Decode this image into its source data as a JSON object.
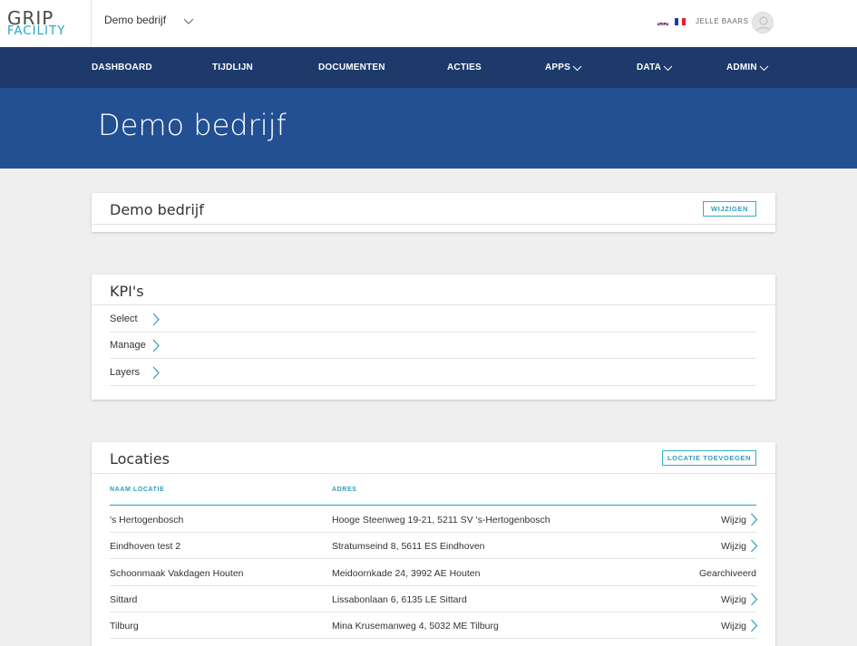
{
  "logo": {
    "top": "GRIP",
    "bottom": "FACILITY"
  },
  "header": {
    "company_select": "Demo bedrijf",
    "languages": [
      "en-flag-icon",
      "fr-flag-icon"
    ],
    "user_name": "JELLE BAARS"
  },
  "nav": {
    "items": [
      {
        "label": "DASHBOARD",
        "dropdown": false
      },
      {
        "label": "TIJDLIJN",
        "dropdown": false
      },
      {
        "label": "DOCUMENTEN",
        "dropdown": false
      },
      {
        "label": "ACTIES",
        "dropdown": false
      },
      {
        "label": "APPS",
        "dropdown": true
      },
      {
        "label": "DATA",
        "dropdown": true
      },
      {
        "label": "ADMIN",
        "dropdown": true
      }
    ]
  },
  "hero": {
    "title": "Demo bedrijf"
  },
  "company_card": {
    "title": "Demo bedrijf",
    "edit_button": "WIJZIGEN"
  },
  "kpi_card": {
    "title": "KPI's",
    "items": [
      {
        "label": "Select"
      },
      {
        "label": "Manage"
      },
      {
        "label": "Layers"
      }
    ]
  },
  "locations_card": {
    "title": "Locaties",
    "add_button": "LOCATIE TOEVOEGEN",
    "columns": {
      "name": "NAAM LOCATIE",
      "address": "ADRES"
    },
    "rows": [
      {
        "name": "'s Hertogenbosch",
        "address": "Hooge Steenweg 19-21, 5211 SV 's-Hertogenbosch",
        "action": "Wijzig"
      },
      {
        "name": "Eindhoven test 2",
        "address": "Stratumseind 8, 5611 ES Eindhoven",
        "action": "Wijzig"
      },
      {
        "name": "Schoonmaak Vakdagen Houten",
        "address": "Meidoornkade 24, 3992 AE Houten",
        "action": "Gearchiveerd"
      },
      {
        "name": "Sittard",
        "address": "Lissabonlaan 6, 6135 LE Sittard",
        "action": "Wijzig"
      },
      {
        "name": "Tilburg",
        "address": "Mina Krusemanweg 4, 5032 ME Tilburg",
        "action": "Wijzig"
      }
    ]
  },
  "colors": {
    "navbar": "#1d3a6b",
    "hero": "#234f93",
    "accent": "#2a9fba"
  }
}
